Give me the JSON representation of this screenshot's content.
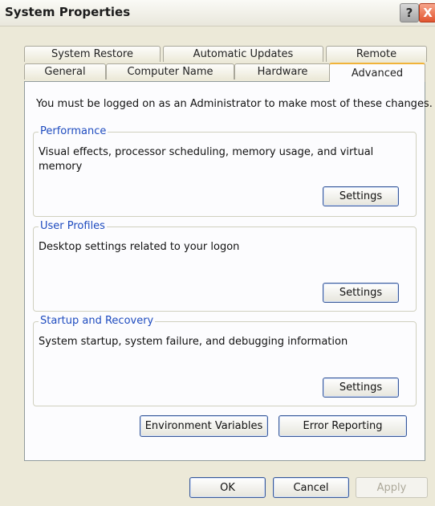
{
  "window": {
    "title": "System Properties"
  },
  "title_buttons": {
    "help": "?",
    "close": "X"
  },
  "tabs_row1": [
    "System Restore",
    "Automatic Updates",
    "Remote"
  ],
  "tabs_row2": [
    "General",
    "Computer Name",
    "Hardware",
    "Advanced"
  ],
  "active_tab": "Advanced",
  "advanced": {
    "intro": "You must be logged on as an Administrator to make most of these changes.",
    "performance": {
      "title": "Performance",
      "description": "Visual effects, processor scheduling, memory usage, and virtual memory",
      "button": "Settings"
    },
    "user_profiles": {
      "title": "User Profiles",
      "description": "Desktop settings related to your logon",
      "button": "Settings"
    },
    "startup_recovery": {
      "title": "Startup and Recovery",
      "description": "System startup, system failure, and debugging information",
      "button": "Settings"
    },
    "env_button": "Environment Variables",
    "error_button": "Error Reporting"
  },
  "footer": {
    "ok": "OK",
    "cancel": "Cancel",
    "apply": "Apply"
  }
}
